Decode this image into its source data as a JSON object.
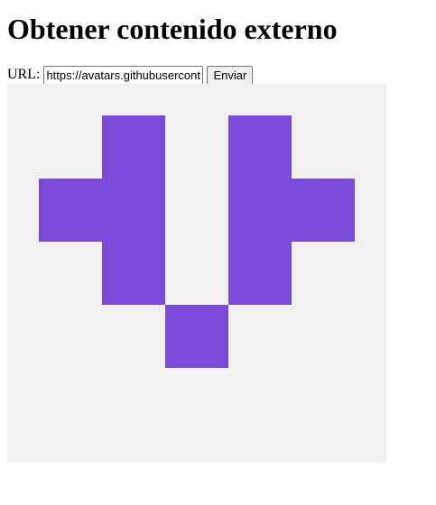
{
  "page": {
    "title": "Obtener contenido externo"
  },
  "form": {
    "url_label": "URL:",
    "url_value": "https://avatars.githubusercontent.com/u/",
    "submit_label": "Enviar"
  },
  "avatar": {
    "background_color": "#F0F0F0",
    "foreground_color": "#7A4AD8",
    "grid_size": 5,
    "pattern": [
      [
        0,
        1,
        0,
        1,
        0
      ],
      [
        1,
        1,
        0,
        1,
        1
      ],
      [
        0,
        1,
        0,
        1,
        0
      ],
      [
        0,
        0,
        1,
        0,
        0
      ],
      [
        0,
        0,
        0,
        0,
        0
      ]
    ]
  }
}
